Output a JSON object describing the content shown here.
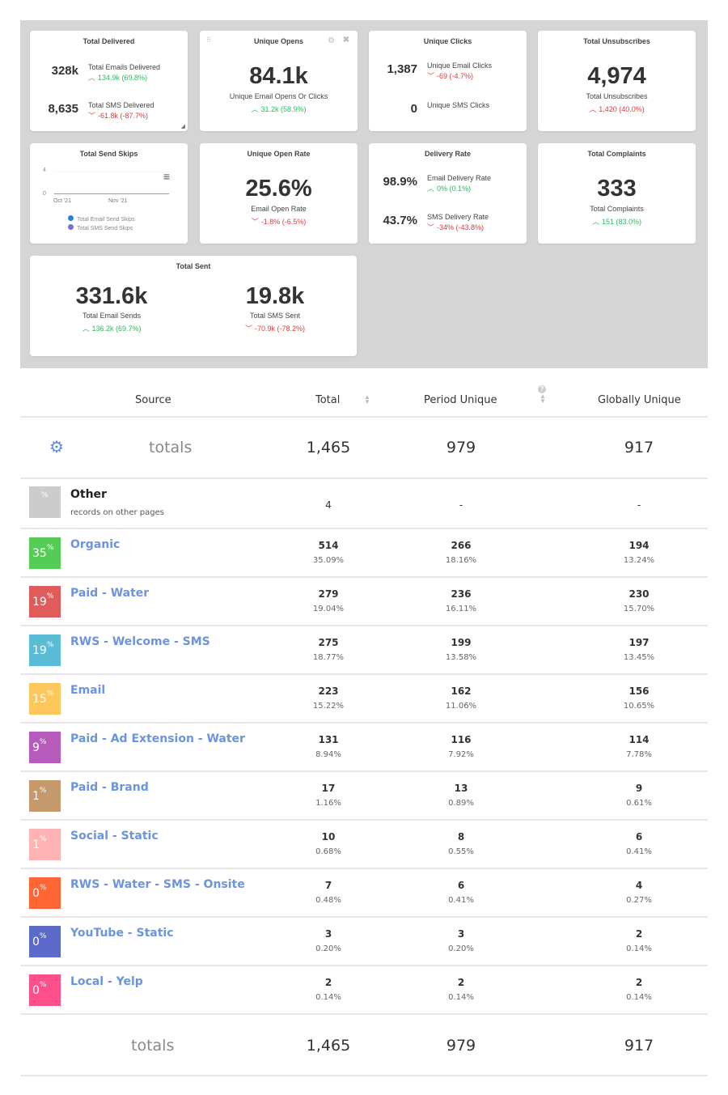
{
  "cards": {
    "total_delivered": {
      "title": "Total Delivered",
      "rows": [
        {
          "value": "328k",
          "label": "Total Emails Delivered",
          "change": "134.9k (69.8%)",
          "dir": "up"
        },
        {
          "value": "8,635",
          "label": "Total SMS Delivered",
          "change": "-61.8k (-87.7%)",
          "dir": "down"
        }
      ]
    },
    "unique_opens": {
      "title": "Unique Opens",
      "value": "84.1k",
      "label": "Unique Email Opens Or Clicks",
      "change": "31.2k (58.9%)",
      "dir": "up"
    },
    "unique_clicks": {
      "title": "Unique Clicks",
      "rows": [
        {
          "value": "1,387",
          "label": "Unique Email Clicks",
          "change": "-69 (-4.7%)",
          "dir": "down"
        },
        {
          "value": "0",
          "label": "Unique SMS Clicks",
          "change": "",
          "dir": ""
        }
      ]
    },
    "total_unsubscribes": {
      "title": "Total Unsubscribes",
      "value": "4,974",
      "label": "Total Unsubscribes",
      "change": "1,420 (40.0%)",
      "dir": "up-bad"
    },
    "total_send_skips": {
      "title": "Total Send Skips",
      "y_ticks": [
        "4",
        "0"
      ],
      "x_ticks": [
        "Oct '21",
        "Nov '21"
      ],
      "legend": [
        "Total Email Send Skips",
        "Total SMS Send Skips"
      ],
      "legend_colors": [
        "#2f7ed8",
        "#6f74d4"
      ]
    },
    "unique_open_rate": {
      "title": "Unique Open Rate",
      "value": "25.6%",
      "label": "Email Open Rate",
      "change": "-1.8% (-6.5%)",
      "dir": "down"
    },
    "delivery_rate": {
      "title": "Delivery Rate",
      "rows": [
        {
          "value": "98.9%",
          "label": "Email Delivery Rate",
          "change": "0% (0.1%)",
          "dir": "up"
        },
        {
          "value": "43.7%",
          "label": "SMS Delivery Rate",
          "change": "-34% (-43.8%)",
          "dir": "down"
        }
      ]
    },
    "total_complaints": {
      "title": "Total Complaints",
      "value": "333",
      "label": "Total Complaints",
      "change": "151 (83.0%)",
      "dir": "up"
    },
    "total_sent": {
      "title": "Total Sent",
      "cols": [
        {
          "value": "331.6k",
          "label": "Total Email Sends",
          "change": "136.2k (69.7%)",
          "dir": "up"
        },
        {
          "value": "19.8k",
          "label": "Total SMS Sent",
          "change": "-70.9k (-78.2%)",
          "dir": "down"
        }
      ]
    }
  },
  "table": {
    "headers": {
      "source": "Source",
      "total": "Total",
      "period_unique": "Period Unique",
      "globally_unique": "Globally Unique"
    },
    "totals_label": "totals",
    "totals": {
      "total": "1,465",
      "period_unique": "979",
      "globally_unique": "917"
    },
    "other": {
      "badge": "%",
      "name": "Other",
      "sub": "records on other pages",
      "total": "4",
      "period_unique": "-",
      "globally_unique": "-"
    },
    "rows": [
      {
        "pct": "35",
        "color": "#55cc55",
        "name": "Organic",
        "total": "514",
        "total_pct": "35.09%",
        "pu": "266",
        "pu_pct": "18.16%",
        "gu": "194",
        "gu_pct": "13.24%"
      },
      {
        "pct": "19",
        "color": "#e05c5c",
        "name": "Paid - Water",
        "total": "279",
        "total_pct": "19.04%",
        "pu": "236",
        "pu_pct": "16.11%",
        "gu": "230",
        "gu_pct": "15.70%"
      },
      {
        "pct": "19",
        "color": "#5bbcd6",
        "name": "RWS - Welcome - SMS",
        "total": "275",
        "total_pct": "18.77%",
        "pu": "199",
        "pu_pct": "13.58%",
        "gu": "197",
        "gu_pct": "13.45%"
      },
      {
        "pct": "15",
        "color": "#fdc75b",
        "name": "Email",
        "total": "223",
        "total_pct": "15.22%",
        "pu": "162",
        "pu_pct": "11.06%",
        "gu": "156",
        "gu_pct": "10.65%"
      },
      {
        "pct": "9",
        "color": "#b65bbb",
        "name": "Paid - Ad Extension - Water",
        "total": "131",
        "total_pct": "8.94%",
        "pu": "116",
        "pu_pct": "7.92%",
        "gu": "114",
        "gu_pct": "7.78%"
      },
      {
        "pct": "1",
        "color": "#c49a6c",
        "name": "Paid - Brand",
        "total": "17",
        "total_pct": "1.16%",
        "pu": "13",
        "pu_pct": "0.89%",
        "gu": "9",
        "gu_pct": "0.61%"
      },
      {
        "pct": "1",
        "color": "#ffb3b3",
        "name": "Social - Static",
        "total": "10",
        "total_pct": "0.68%",
        "pu": "8",
        "pu_pct": "0.55%",
        "gu": "6",
        "gu_pct": "0.41%"
      },
      {
        "pct": "0",
        "color": "#ff6633",
        "name": "RWS - Water - SMS - Onsite",
        "total": "7",
        "total_pct": "0.48%",
        "pu": "6",
        "pu_pct": "0.41%",
        "gu": "4",
        "gu_pct": "0.27%"
      },
      {
        "pct": "0",
        "color": "#5c6bc9",
        "name": "YouTube - Static",
        "total": "3",
        "total_pct": "0.20%",
        "pu": "3",
        "pu_pct": "0.20%",
        "gu": "2",
        "gu_pct": "0.14%"
      },
      {
        "pct": "0",
        "color": "#ff4f8a",
        "name": "Local - Yelp",
        "total": "2",
        "total_pct": "0.14%",
        "pu": "2",
        "pu_pct": "0.14%",
        "gu": "2",
        "gu_pct": "0.14%"
      }
    ]
  },
  "icons": {
    "up": "▲",
    "down": "▼",
    "gear": "⚙",
    "close": "✖",
    "menu": "≡",
    "sort": "⇕",
    "help": "?"
  }
}
